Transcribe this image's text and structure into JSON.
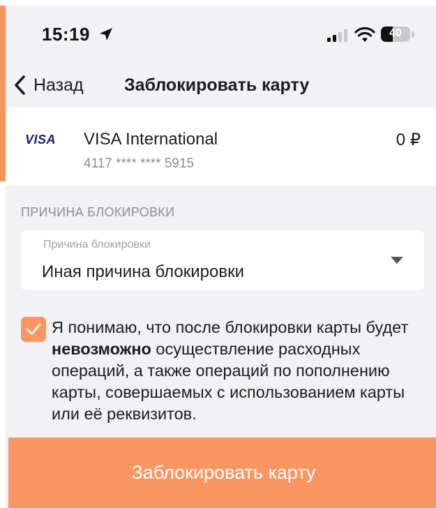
{
  "status_bar": {
    "time": "15:19",
    "battery": "40",
    "battery_level": 0.4
  },
  "nav": {
    "back_label": "Назад",
    "title": "Заблокировать карту"
  },
  "card": {
    "brand": "VISA",
    "name": "VISA  International",
    "number": "4117 **** **** 5915",
    "balance": "0 ₽"
  },
  "reason_section": {
    "header": "ПРИЧИНА БЛОКИРОВКИ",
    "field_label": "Причина блокировки",
    "selected_value": "Иная причина блокировки"
  },
  "consent": {
    "checked": true,
    "text_before": "Я понимаю, что после блокировки карты будет ",
    "text_bold": "невозможно",
    "text_after": " осуществление расходных операций, а также операций по пополнению карты, совершаемых с использованием карты или её реквизитов."
  },
  "submit_button": {
    "label": "Заблокировать карту"
  },
  "colors": {
    "accent": "#fb9662",
    "background": "#f2f2f4",
    "visa": "#1a1f71"
  }
}
